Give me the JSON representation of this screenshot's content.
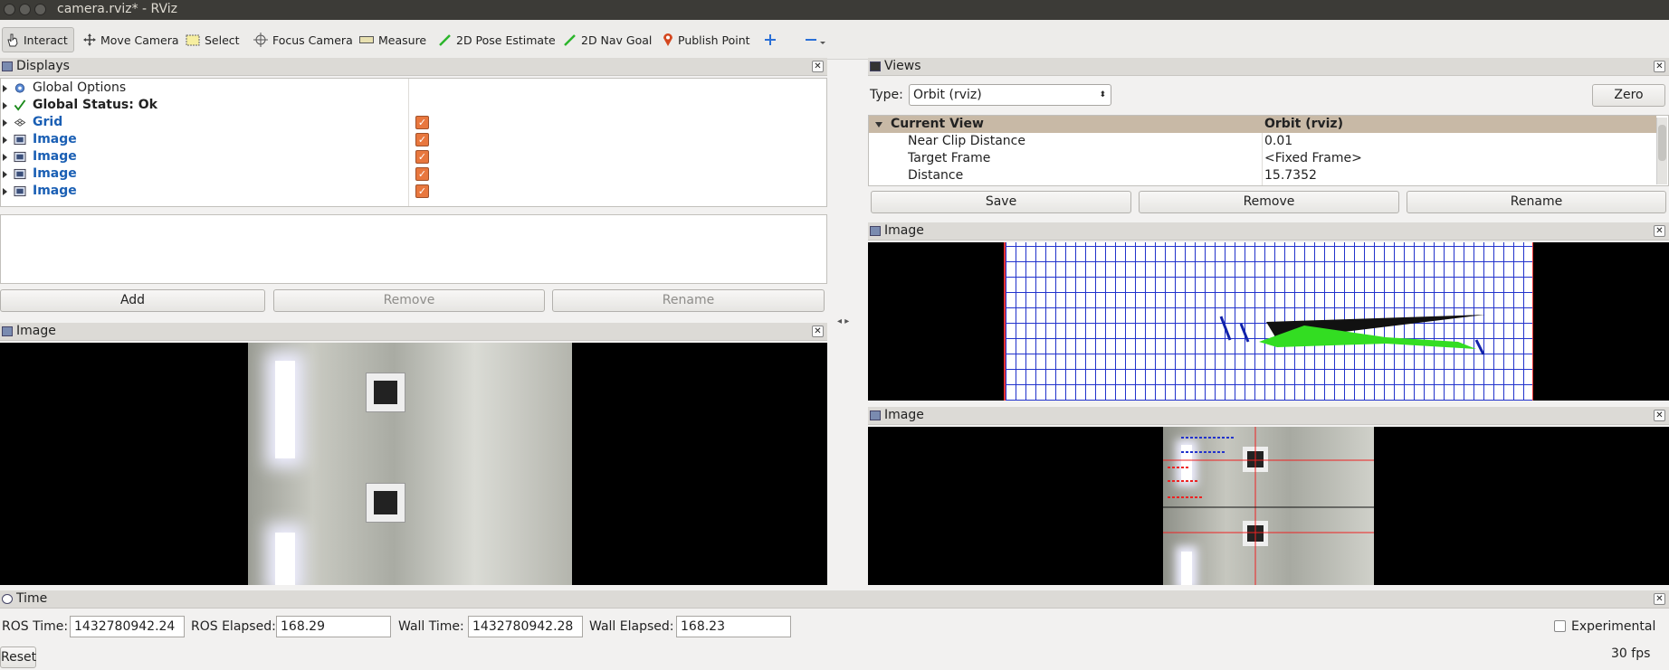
{
  "window": {
    "title": "camera.rviz* - RViz"
  },
  "toolbar": {
    "interact": "Interact",
    "move_camera": "Move Camera",
    "select": "Select",
    "focus_camera": "Focus Camera",
    "measure": "Measure",
    "pose_estimate": "2D Pose Estimate",
    "nav_goal": "2D Nav Goal",
    "publish_point": "Publish Point"
  },
  "displays": {
    "title": "Displays",
    "items": [
      {
        "label": "Global Options"
      },
      {
        "label": "Global Status: Ok"
      },
      {
        "label": "Grid",
        "checked": true
      },
      {
        "label": "Image",
        "checked": true
      },
      {
        "label": "Image",
        "checked": true
      },
      {
        "label": "Image",
        "checked": true
      },
      {
        "label": "Image",
        "checked": true
      }
    ],
    "add": "Add",
    "remove": "Remove",
    "rename": "Rename"
  },
  "image_panel_left": {
    "title": "Image"
  },
  "views": {
    "title": "Views",
    "type_label": "Type:",
    "type_value": "Orbit (rviz)",
    "zero": "Zero",
    "header_name": "Current View",
    "header_value": "Orbit (rviz)",
    "props": [
      {
        "name": "Near Clip Distance",
        "value": "0.01"
      },
      {
        "name": "Target Frame",
        "value": "<Fixed Frame>"
      },
      {
        "name": "Distance",
        "value": "15.7352"
      }
    ],
    "save": "Save",
    "remove": "Remove",
    "rename": "Rename"
  },
  "image_panel_right_top": {
    "title": "Image"
  },
  "image_panel_right_bottom": {
    "title": "Image"
  },
  "time": {
    "title": "Time",
    "ros_time_label": "ROS Time:",
    "ros_time": "1432780942.24",
    "ros_elapsed_label": "ROS Elapsed:",
    "ros_elapsed": "168.29",
    "wall_time_label": "Wall Time:",
    "wall_time": "1432780942.28",
    "wall_elapsed_label": "Wall Elapsed:",
    "wall_elapsed": "168.23",
    "experimental": "Experimental",
    "reset": "Reset",
    "fps": "30 fps"
  },
  "colors": {
    "accent_check": "#e8773e",
    "title_bg": "#3c3b37",
    "grid_line": "#2233cc"
  }
}
